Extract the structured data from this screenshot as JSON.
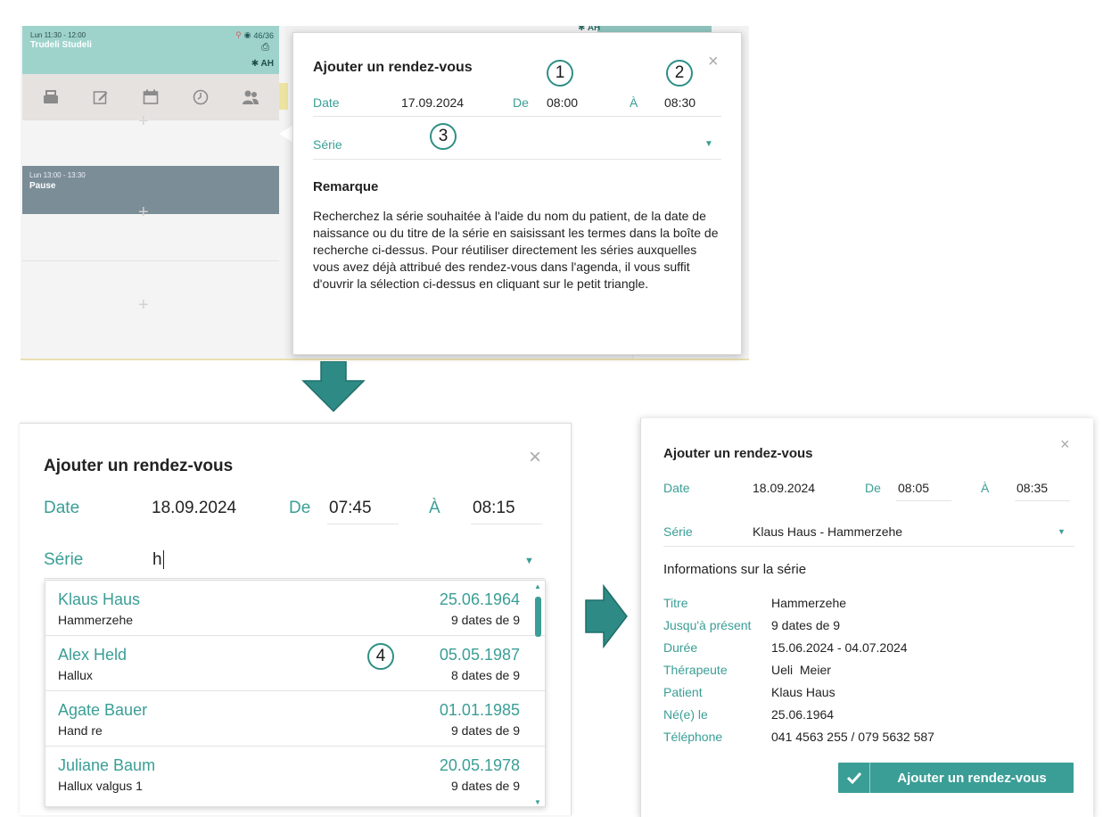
{
  "calendar": {
    "appointment": {
      "time": "Lun 11:30 - 12:00",
      "name": "Trudeli Studeli",
      "count": "46/36",
      "badge": "AH"
    },
    "pause": {
      "time": "Lun 13:00 - 13:30",
      "label": "Pause"
    },
    "toolbar_icons": [
      "inbox-icon",
      "edit-icon",
      "calendar-icon",
      "clock-icon",
      "users-icon"
    ],
    "header_right_badge": "AH"
  },
  "dialog1": {
    "title": "Ajouter un rendez-vous",
    "date_label": "Date",
    "date_value": "17.09.2024",
    "from_label": "De",
    "from_value": "08:00",
    "to_label": "À",
    "to_value": "08:30",
    "series_label": "Série",
    "remark_heading": "Remarque",
    "remark_text": "Recherchez la série souhaitée à l'aide du nom du patient, de la date de naissance ou du titre de la série en saisissant les termes dans la boîte de recherche ci-dessus. Pour réutiliser directement les séries auxquelles vous avez déjà attribué des rendez-vous dans l'agenda, il vous suffit d'ouvrir la sélection ci-dessus en cliquant sur le petit triangle.",
    "callouts": [
      "1",
      "2",
      "3"
    ]
  },
  "dialog2": {
    "title": "Ajouter un rendez-vous",
    "date_label": "Date",
    "date_value": "18.09.2024",
    "from_label": "De",
    "from_value": "07:45",
    "to_label": "À",
    "to_value": "08:15",
    "series_label": "Série",
    "series_input": "h",
    "callout": "4",
    "results": [
      {
        "name": "Klaus Haus",
        "title": "Hammerzehe",
        "date": "25.06.1964",
        "count": "9 dates de 9"
      },
      {
        "name": "Alex Held",
        "title": "Hallux",
        "date": "05.05.1987",
        "count": "8 dates de 9"
      },
      {
        "name": "Agate Bauer",
        "title": "Hand re",
        "date": "01.01.1985",
        "count": "9 dates de 9"
      },
      {
        "name": "Juliane Baum",
        "title": "Hallux valgus 1",
        "date": "20.05.1978",
        "count": "9 dates de 9"
      }
    ]
  },
  "dialog3": {
    "title": "Ajouter un rendez-vous",
    "date_label": "Date",
    "date_value": "18.09.2024",
    "from_label": "De",
    "from_value": "08:05",
    "to_label": "À",
    "to_value": "08:35",
    "series_label": "Série",
    "series_value": "Klaus Haus - Hammerzehe",
    "info_heading": "Informations sur la série",
    "info": [
      {
        "label": "Titre",
        "value": "Hammerzehe"
      },
      {
        "label": "Jusqu'à présent",
        "value": "9 dates de 9"
      },
      {
        "label": "Durée",
        "value": "15.06.2024 - 04.07.2024"
      },
      {
        "label": "Thérapeute",
        "value": "Ueli  Meier"
      },
      {
        "label": "Patient",
        "value": "Klaus Haus"
      },
      {
        "label": "Né(e) le",
        "value": "25.06.1964"
      },
      {
        "label": "Téléphone",
        "value": "041 4563 255 / 079 5632 587"
      }
    ],
    "add_button": "Ajouter un rendez-vous"
  },
  "colors": {
    "accent": "#3a9e96",
    "appointment": "#9ed3cc",
    "pause": "#7b8e97",
    "arrow": "#2e8a84"
  }
}
